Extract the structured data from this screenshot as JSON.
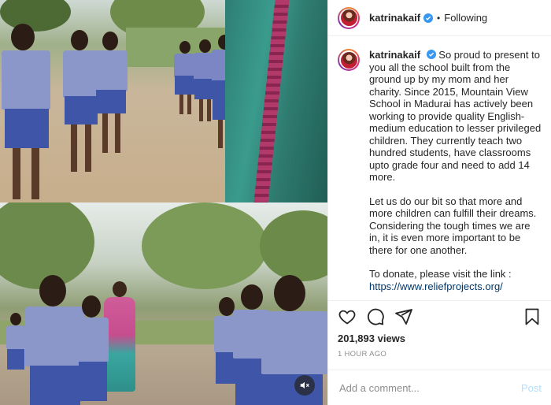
{
  "header": {
    "username": "katrinakaif",
    "verified_icon": "verified-badge-icon",
    "separator": "•",
    "follow_status": "Following"
  },
  "caption": {
    "username": "katrinakaif",
    "paragraph1": "So proud to present to you all the school built from the ground up by my mom and her charity. Since 2015, Mountain View School in Madurai has actively been working to provide quality English-medium education to lesser privileged children. They currently teach two hundred students, have classrooms upto grade four and need to add 14 more.",
    "paragraph2": "Let us do our bit so that more and more children can fulfill their dreams. Considering the tough times we are in, it is even more important to be there for one another.",
    "paragraph3_prefix": "To donate, please visit the link :",
    "link": "https://www.reliefprojects.org/"
  },
  "actions": {
    "icons": [
      "heart-icon",
      "comment-icon",
      "share-icon",
      "bookmark-icon"
    ],
    "views": "201,893 views",
    "timestamp": "1 HOUR AGO"
  },
  "comment_box": {
    "placeholder": "Add a comment...",
    "post_label": "Post"
  },
  "media": {
    "type": "video",
    "sound_icon": "speaker-muted-icon"
  },
  "colors": {
    "link": "#00376b",
    "post_button_disabled": "#b2dffc",
    "verified": "#3897f0",
    "muted_text": "#8e8e8e"
  }
}
